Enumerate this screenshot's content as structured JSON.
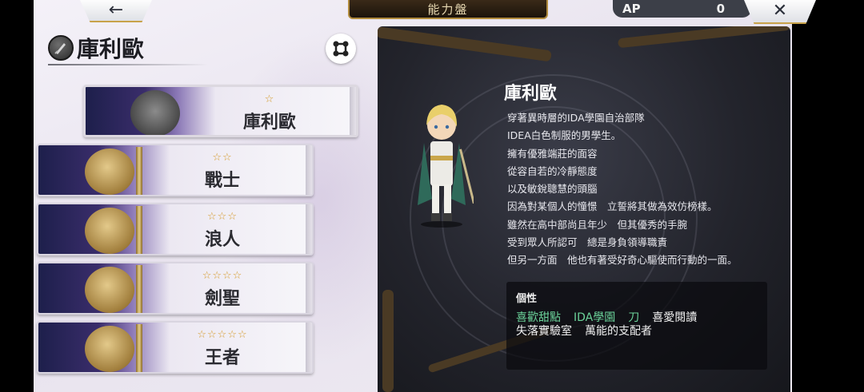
{
  "topbar": {
    "back_label": "←",
    "title": "能力盤",
    "ap_label": "AP",
    "ap_value": "0",
    "close_label": "✕"
  },
  "character": {
    "name": "庫利歐"
  },
  "jobs": [
    {
      "stars": "☆",
      "name": "庫利歐"
    },
    {
      "stars": "☆☆",
      "name": "戰士"
    },
    {
      "stars": "☆☆☆",
      "name": "浪人"
    },
    {
      "stars": "☆☆☆☆",
      "name": "劍聖"
    },
    {
      "stars": "☆☆☆☆☆",
      "name": "王者"
    }
  ],
  "info": {
    "name": "庫利歐",
    "description": [
      "穿著異時層的IDA學園自治部隊",
      "IDEA白色制服的男學生。",
      "擁有優雅端莊的面容",
      "從容自若的冷靜態度",
      "以及敏銳聰慧的頭腦",
      "因為對某個人的憧憬　立誓將其做為效仿榜樣。",
      "雖然在高中部尚且年少　但其優秀的手腕",
      "受到眾人所認可　總是身負領導職責",
      "但另一方面　他也有著受好奇心驅使而行動的一面。"
    ],
    "traits_title": "個性",
    "traits_row1": [
      {
        "text": "喜歡甜點",
        "color": "green"
      },
      {
        "text": "IDA學園",
        "color": "green"
      },
      {
        "text": "刀",
        "color": "green"
      },
      {
        "text": "喜愛閱讀",
        "color": "white"
      }
    ],
    "traits_row2": [
      {
        "text": "失落實驗室",
        "color": "white"
      },
      {
        "text": "萬能的支配者",
        "color": "white"
      }
    ]
  },
  "colors": {
    "trait_green": "#6bd39a",
    "star_gold": "#d59a2a",
    "panel_dark": "#23242c"
  },
  "icons": {
    "back": "arrow-left-icon",
    "close": "close-icon",
    "header": "sword-badge-icon",
    "toggle": "expand-nodes-icon"
  }
}
